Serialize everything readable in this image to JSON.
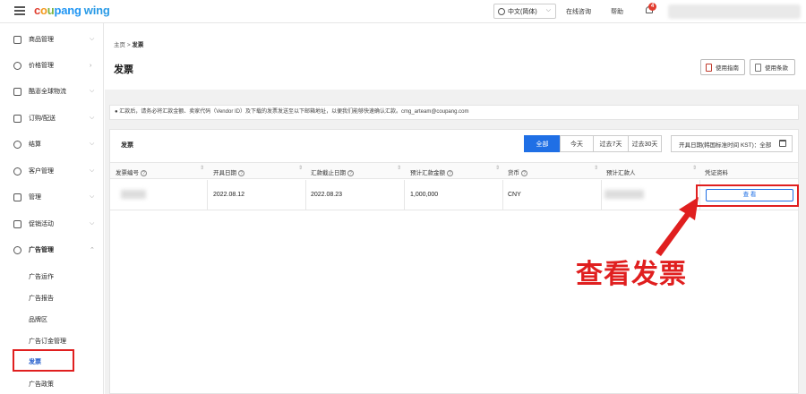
{
  "topbar": {
    "logo": {
      "c": "c",
      "o": "o",
      "u": "u",
      "pang": "pang",
      "wing": "wing"
    },
    "language": "中文(简体)",
    "nav": [
      "在线咨询",
      "帮助"
    ],
    "notification_count": "4"
  },
  "sidebar": {
    "items": [
      {
        "label": "商品管理",
        "icon": "box-icon"
      },
      {
        "label": "价格管理",
        "icon": "medal-icon"
      },
      {
        "label": "酷澎全球物流",
        "icon": "rocket-icon"
      },
      {
        "label": "订购/配送",
        "icon": "truck-icon"
      },
      {
        "label": "结算",
        "icon": "coin-icon"
      },
      {
        "label": "客户管理",
        "icon": "smile-icon"
      },
      {
        "label": "管理",
        "icon": "store-icon"
      },
      {
        "label": "促销活动",
        "icon": "coupon-icon"
      },
      {
        "label": "广告管理",
        "icon": "ad-icon"
      }
    ],
    "sub_items": [
      "广告运作",
      "广告报告",
      "品牌区",
      "广告订金管理",
      "发票",
      "广告政策"
    ],
    "active_sub": "发票"
  },
  "breadcrumb": {
    "home": "主页",
    "sep": ">",
    "current": "发票"
  },
  "page_title": "发票",
  "header_buttons": [
    "使用指南",
    "使用条款"
  ],
  "notice": "汇款后，请务必将汇款金额、卖家代码（Vendor ID）及下载的发票发送至以下邮箱地址，以便我们能够快速确认汇款。cmg_arteam@coupang.com",
  "card": {
    "title": "发票",
    "filters": [
      "全部",
      "今天",
      "过去7天",
      "过去30天"
    ],
    "active_filter": "全部",
    "date_filter": "开具日期(韩国标准时间 KST)：全部",
    "columns": [
      "发票编号",
      "开具日期",
      "汇款截止日期",
      "预计汇款金额",
      "货币",
      "预计汇款人",
      "凭证资料"
    ],
    "row": {
      "issue_date": "2022.08.12",
      "due_date": "2022.08.23",
      "amount": "1,000,000",
      "currency": "CNY",
      "view": "查 看"
    }
  },
  "annotation": "查看发票",
  "colors": {
    "accent": "#1f6fe5",
    "highlight": "#e01f1f"
  }
}
